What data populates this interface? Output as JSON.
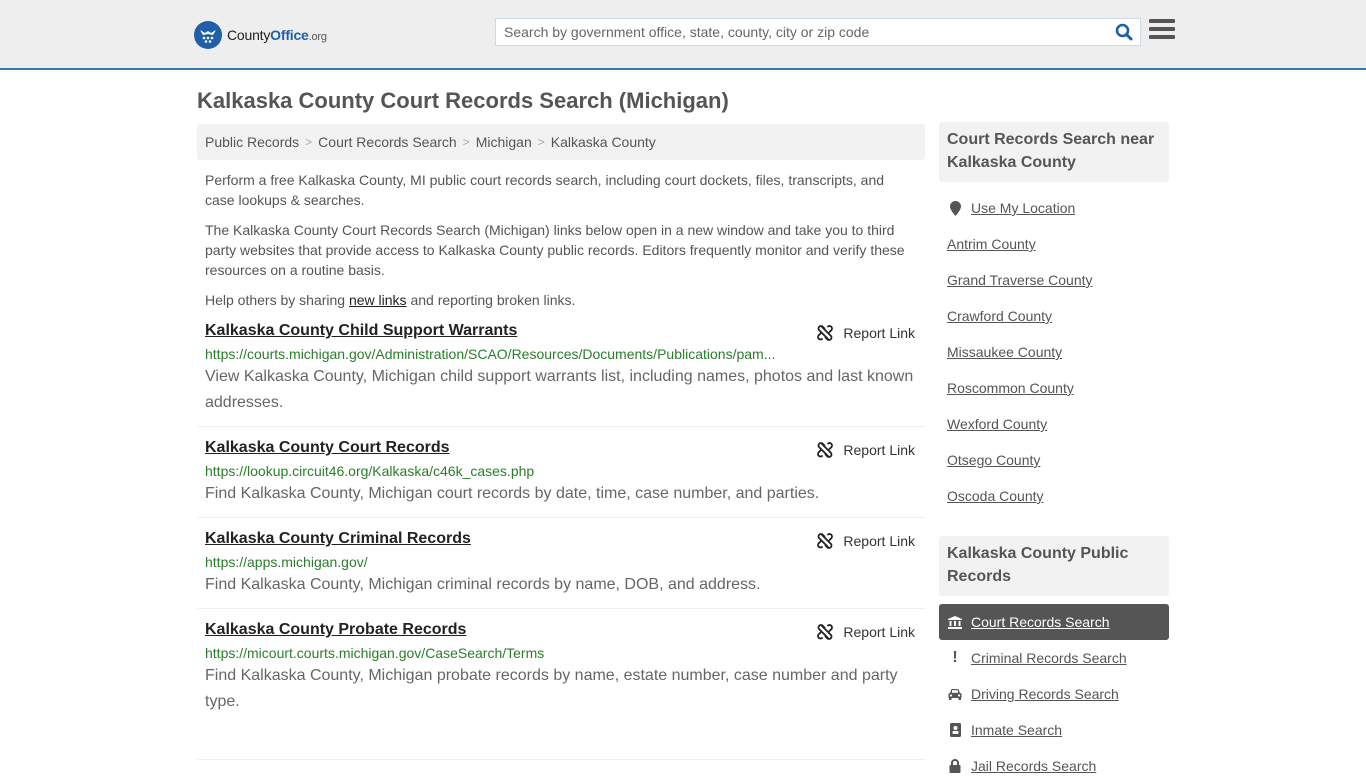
{
  "header": {
    "logo": {
      "brand_a": "County",
      "brand_b": "Office",
      "brand_c": ".org"
    },
    "search": {
      "placeholder": "Search by government office, state, county, city or zip code",
      "value": "",
      "icon": "search-icon"
    },
    "menu_icon": "hamburger-menu-icon"
  },
  "page": {
    "title": "Kalkaska County Court Records Search (Michigan)",
    "breadcrumb": [
      "Public Records",
      "Court Records Search",
      "Michigan",
      "Kalkaska County"
    ],
    "intro": {
      "p1": "Perform a free Kalkaska County, MI public court records search, including court dockets, files, transcripts, and case lookups & searches.",
      "p2": "The Kalkaska County Court Records Search (Michigan) links below open in a new window and take you to third party websites that provide access to Kalkaska County public records. Editors frequently monitor and verify these resources on a routine basis.",
      "p3_before": "Help others by sharing ",
      "p3_link": "new links",
      "p3_after": " and reporting broken links."
    },
    "report_label": "Report Link",
    "results": [
      {
        "title": "Kalkaska County Child Support Warrants",
        "url": "https://courts.michigan.gov/Administration/SCAO/Resources/Documents/Publications/pam...",
        "description": "View Kalkaska County, Michigan child support warrants list, including names, photos and last known addresses."
      },
      {
        "title": "Kalkaska County Court Records",
        "url": "https://lookup.circuit46.org/Kalkaska/c46k_cases.php",
        "description": "Find Kalkaska County, Michigan court records by date, time, case number, and parties."
      },
      {
        "title": "Kalkaska County Criminal Records",
        "url": "https://apps.michigan.gov/",
        "description": "Find Kalkaska County, Michigan criminal records by name, DOB, and address."
      },
      {
        "title": "Kalkaska County Probate Records",
        "url": "https://micourt.courts.michigan.gov/CaseSearch/Terms",
        "description": "Find Kalkaska County, Michigan probate records by name, estate number, case number and party type."
      }
    ]
  },
  "sidebar": {
    "nearby": {
      "heading": "Court Records Search near Kalkaska County",
      "use_location": "Use My Location",
      "counties": [
        "Antrim County",
        "Grand Traverse County",
        "Crawford County",
        "Missaukee County",
        "Roscommon County",
        "Wexford County",
        "Otsego County",
        "Oscoda County"
      ]
    },
    "public_records": {
      "heading": "Kalkaska County Public Records",
      "items": [
        {
          "label": "Court Records Search",
          "icon": "courthouse-icon",
          "active": true
        },
        {
          "label": "Criminal Records Search",
          "icon": "exclamation-icon",
          "active": false
        },
        {
          "label": "Driving Records Search",
          "icon": "car-icon",
          "active": false
        },
        {
          "label": "Inmate Search",
          "icon": "id-badge-icon",
          "active": false
        },
        {
          "label": "Jail Records Search",
          "icon": "lock-icon",
          "active": false
        }
      ]
    }
  },
  "colors": {
    "brand": "#1e5fa8",
    "header_border": "#3a79a9",
    "url_green": "#2b7d2b",
    "active_bg": "#555555"
  }
}
